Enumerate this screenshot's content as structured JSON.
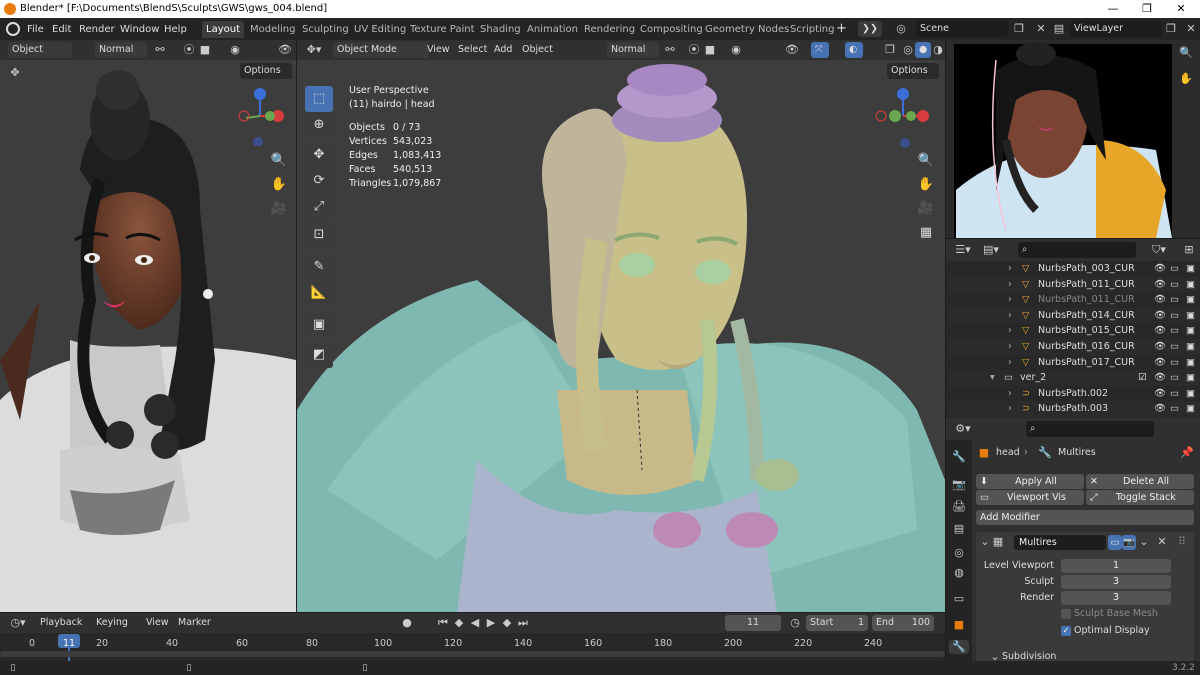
{
  "title_bar": {
    "title": "Blender* [F:\\Documents\\BlendS\\Sculpts\\GWS\\gws_004.blend]"
  },
  "menu": {
    "items": [
      "File",
      "Edit",
      "Render",
      "Window",
      "Help"
    ]
  },
  "workspaces": {
    "tabs": [
      "Layout",
      "Modeling",
      "Sculpting",
      "UV Editing",
      "Texture Paint",
      "Shading",
      "Animation",
      "Rendering",
      "Compositing",
      "Geometry Nodes",
      "Scripting"
    ],
    "active": "Layout"
  },
  "scene": {
    "name": "Scene",
    "view_layer": "ViewLayer"
  },
  "left_viewport": {
    "mode": "Object",
    "orientation": "Normal",
    "options": "Options"
  },
  "main_viewport": {
    "mode": "Object Mode",
    "menus": [
      "View",
      "Select",
      "Add",
      "Object"
    ],
    "orientation": "Normal",
    "options": "Options",
    "perspective": "User Perspective",
    "active": "(11) hairdo | head",
    "stats": [
      {
        "label": "Objects",
        "value": "0 / 73"
      },
      {
        "label": "Vertices",
        "value": "543,023"
      },
      {
        "label": "Edges",
        "value": "1,083,413"
      },
      {
        "label": "Faces",
        "value": "540,513"
      },
      {
        "label": "Triangles",
        "value": "1,079,867"
      }
    ]
  },
  "outliner": {
    "rows": [
      {
        "name": "NurbsPath_003_CUR",
        "type": "curve",
        "dim": false
      },
      {
        "name": "NurbsPath_011_CUR",
        "type": "curve",
        "dim": false
      },
      {
        "name": "NurbsPath_011_CUR",
        "type": "curve",
        "dim": true
      },
      {
        "name": "NurbsPath_014_CUR",
        "type": "curve",
        "dim": false
      },
      {
        "name": "NurbsPath_015_CUR",
        "type": "curve",
        "dim": false
      },
      {
        "name": "NurbsPath_016_CUR",
        "type": "curve",
        "dim": false
      },
      {
        "name": "NurbsPath_017_CUR",
        "type": "curve",
        "dim": false
      },
      {
        "name": "ver_2",
        "type": "collection",
        "dim": false
      },
      {
        "name": "NurbsPath.002",
        "type": "path",
        "dim": false
      },
      {
        "name": "NurbsPath.003",
        "type": "path",
        "dim": false
      }
    ]
  },
  "properties": {
    "object": "head",
    "modifier_breadcrumb": "Multires",
    "apply_all": "Apply All",
    "delete_all": "Delete All",
    "viewport_vis": "Viewport Vis",
    "toggle_stack": "Toggle Stack",
    "add_modifier": "Add Modifier",
    "modifier_name": "Multires",
    "level_viewport_label": "Level Viewport",
    "level_viewport": "1",
    "sculpt_label": "Sculpt",
    "sculpt": "3",
    "render_label": "Render",
    "render": "3",
    "sculpt_base_mesh": "Sculpt Base Mesh",
    "optimal_display": "Optimal Display",
    "subdivision": "Subdivision"
  },
  "timeline": {
    "menus": [
      "Playback",
      "Keying",
      "View",
      "Marker"
    ],
    "current_frame": "11",
    "start_label": "Start",
    "start": "1",
    "end_label": "End",
    "end": "100",
    "ticks": [
      "0",
      "11",
      "20",
      "40",
      "60",
      "80",
      "100",
      "120",
      "140",
      "160",
      "180",
      "200",
      "220",
      "240"
    ]
  },
  "status_bar": {
    "version": "3.2.2"
  },
  "colors": {
    "accent": "#4772b3",
    "orange": "#e87d0d",
    "viewport_bg": "#3d3d3d"
  }
}
